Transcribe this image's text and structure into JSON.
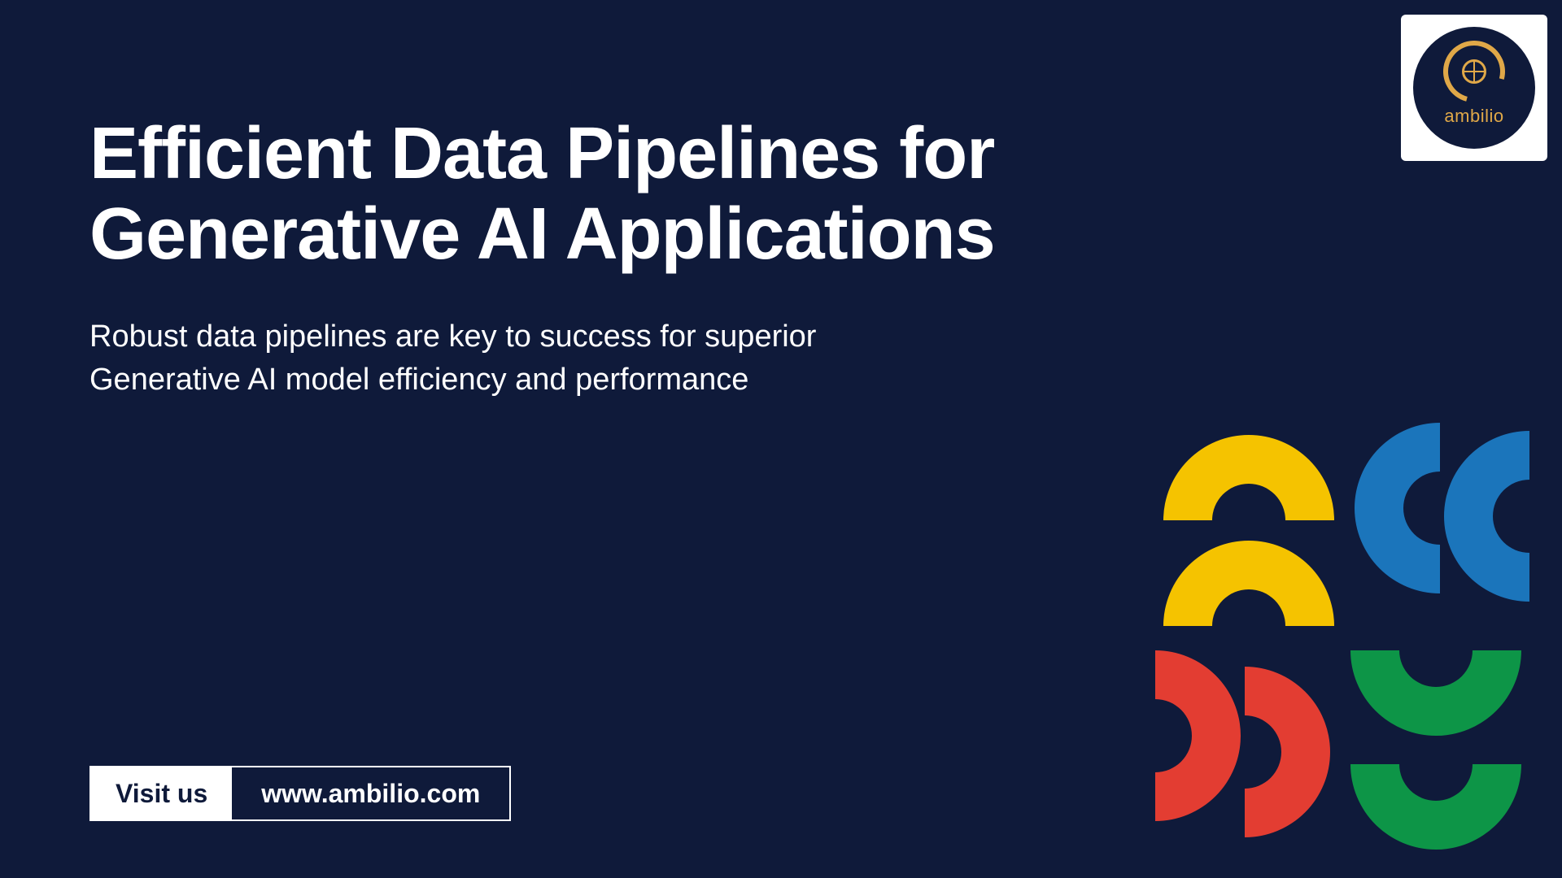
{
  "title": "Efficient Data Pipelines for Generative AI Applications",
  "subtitle": "Robust data pipelines are key to success for superior Generative AI model efficiency and performance",
  "cta": {
    "label": "Visit us",
    "url": "www.ambilio.com"
  },
  "logo": {
    "text": "ambilio"
  },
  "colors": {
    "background": "#0f1a3a",
    "yellow": "#f5c300",
    "blue": "#1b75bb",
    "red": "#e33d32",
    "green": "#0d9547",
    "logo_accent": "#e0a848"
  }
}
